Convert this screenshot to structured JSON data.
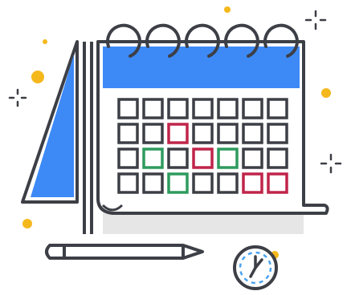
{
  "illustration": {
    "icon": "calendar-planner-icon",
    "parts": [
      "calendar-icon",
      "pencil-icon",
      "clock-icon",
      "sparkle-icon",
      "dot-icon"
    ]
  },
  "colors": {
    "outline": "#3d3f46",
    "header_blue": "#3d8af7",
    "accent_red": "#c0254a",
    "accent_green": "#2e9b5e",
    "dot_yellow": "#f5b81c",
    "clock_blue": "#4aa3ef",
    "shadow": "#e6e6e6",
    "paper": "#ffffff"
  },
  "calendar": {
    "rows": 4,
    "cols": 7,
    "highlights": [
      {
        "row": 1,
        "col": 2,
        "state": "red"
      },
      {
        "row": 2,
        "col": 1,
        "state": "green"
      },
      {
        "row": 2,
        "col": 3,
        "state": "red"
      },
      {
        "row": 2,
        "col": 4,
        "state": "green"
      },
      {
        "row": 3,
        "col": 2,
        "state": "green"
      },
      {
        "row": 3,
        "col": 5,
        "state": "red"
      },
      {
        "row": 3,
        "col": 6,
        "state": "red"
      }
    ]
  }
}
